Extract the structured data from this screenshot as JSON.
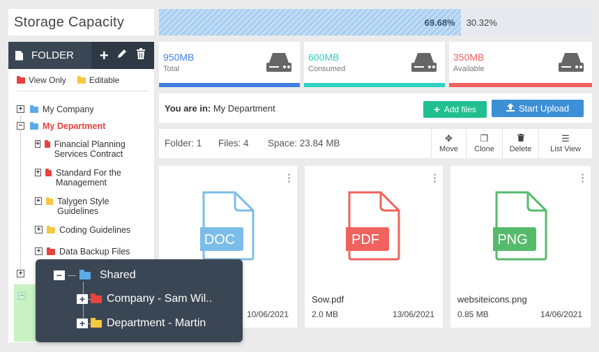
{
  "header": {
    "title": "Storage Capacity",
    "used_percent_label": "69.68%",
    "free_percent_label": "30.32%",
    "used_fraction": 0.6968
  },
  "sidebar": {
    "folder_title": "FOLDER",
    "legend": {
      "view_only": "View Only",
      "editable": "Editable"
    },
    "tree": [
      {
        "label": "My Company"
      },
      {
        "label": "My Department"
      },
      {
        "label": "Financial Planning Services Contract"
      },
      {
        "label": "Standard For the Management"
      },
      {
        "label": "Talygen Style Guidelines"
      },
      {
        "label": "Coding Guidelines"
      },
      {
        "label": "Data Backup Files"
      }
    ]
  },
  "stats": [
    {
      "value": "950MB",
      "label": "Total",
      "color": "#3f7fe0"
    },
    {
      "value": "600MB",
      "label": "Consumed",
      "color": "#2fd1c3"
    },
    {
      "value": "350MB",
      "label": "Available",
      "color": "#f0625d"
    }
  ],
  "breadcrumb": {
    "prefix": "You are in:",
    "location": "My Department",
    "add_files": "Add files",
    "start_upload": "Start Upload"
  },
  "info": {
    "folder": "Folder: 1",
    "files": "Files: 4",
    "space": "Space: 23.84 MB",
    "tools": {
      "move": "Move",
      "clone": "Clone",
      "delete": "Delete",
      "list_view": "List View"
    }
  },
  "files": [
    {
      "type": "DOC",
      "color": "#7bbde8",
      "name": "",
      "size": "",
      "date": "10/06/2021"
    },
    {
      "type": "PDF",
      "color": "#f0625d",
      "name": "Sow.pdf",
      "size": "2.0 MB",
      "date": "13/06/2021"
    },
    {
      "type": "PNG",
      "color": "#55bb6a",
      "name": "websiteicons.png",
      "size": "0.85 MB",
      "date": "14/06/2021"
    }
  ],
  "overlay": {
    "shared": "Shared",
    "company": "Company - Sam Wil..",
    "department": "Department - Martin"
  }
}
